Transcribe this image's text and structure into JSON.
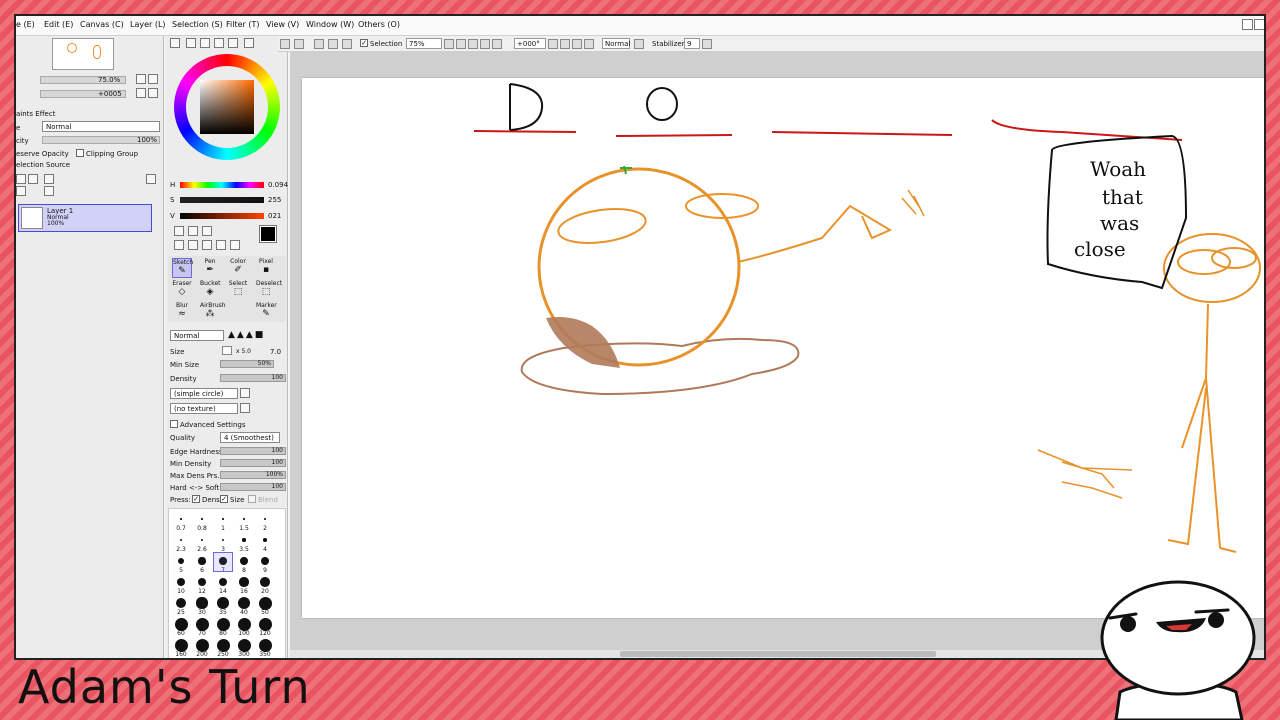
{
  "menu": {
    "items": [
      "e (E)",
      "Edit (E)",
      "Canvas (C)",
      "Layer (L)",
      "Selection (S)",
      "Filter (T)",
      "View (V)",
      "Window (W)",
      "Others (O)"
    ]
  },
  "toolbar": {
    "selection_label": "Selection",
    "zoom_value": "75%",
    "rotation_value": "+000°",
    "blend_mode": "Normal",
    "stabilizer_label": "Stabilizer",
    "stabilizer_value": "9"
  },
  "navigator": {
    "zoom_value": "75.0%",
    "angle_value": "+0005"
  },
  "layer_panel": {
    "section_title": "aints Effect",
    "mode_label": "e",
    "mode_value": "Normal",
    "opacity_label": "city",
    "opacity_value": "100%",
    "preserve_opacity_label": "eserve Opacity",
    "clipping_group_label": "Clipping Group",
    "selection_source_label": "election Source",
    "layer": {
      "name": "Layer 1",
      "mode": "Normal",
      "opacity": "100%"
    }
  },
  "color": {
    "h_label": "H",
    "h_value": "0.094",
    "s_label": "S",
    "s_value": "255",
    "v_label": "V",
    "v_value": "021"
  },
  "tools": {
    "row1": [
      {
        "label": "Sketch",
        "glyph": "✎"
      },
      {
        "label": "Pen",
        "glyph": "✒"
      },
      {
        "label": "Color",
        "glyph": "✐"
      },
      {
        "label": "Pixel",
        "glyph": "▪"
      }
    ],
    "row2": [
      {
        "label": "Eraser",
        "glyph": "◇"
      },
      {
        "label": "Bucket",
        "glyph": "◈"
      },
      {
        "label": "Select",
        "glyph": "⬚"
      },
      {
        "label": "Deselect",
        "glyph": "⬚"
      }
    ],
    "row3": [
      {
        "label": "Blur",
        "glyph": "≈"
      },
      {
        "label": "AirBrush",
        "glyph": "⁂"
      },
      {
        "label": "",
        "glyph": ""
      },
      {
        "label": "Marker",
        "glyph": "✎"
      }
    ]
  },
  "brush": {
    "blend_mode": "Normal",
    "size_label": "Size",
    "size_mult": "x 5.0",
    "size_value": "7.0",
    "min_size_label": "Min Size",
    "min_size_value": "50%",
    "density_label": "Density",
    "density_value": "100",
    "shape": "(simple circle)",
    "texture": "(no texture)",
    "advanced_label": "Advanced Settings",
    "quality_label": "Quality",
    "quality_value": "4 (Smoothest)",
    "edge_hardness_label": "Edge Hardness",
    "edge_hardness_value": "100",
    "min_density_label": "Min Density",
    "min_density_value": "100",
    "max_dens_label": "Max Dens Prs.",
    "max_dens_value": "100%",
    "hard_soft_label": "Hard <-> Soft",
    "hard_soft_value": "100",
    "press_label": "Press:",
    "dens_label": "Dens",
    "size_chk_label": "Size",
    "blend_label": "Blend"
  },
  "brush_sizes": [
    "0.7",
    "0.8",
    "1",
    "1.5",
    "2",
    "2.3",
    "2.6",
    "3",
    "3.5",
    "4",
    "5",
    "6",
    "7",
    "8",
    "9",
    "10",
    "12",
    "14",
    "16",
    "20",
    "25",
    "30",
    "35",
    "40",
    "50",
    "60",
    "70",
    "80",
    "100",
    "120",
    "160",
    "200",
    "250",
    "300",
    "350"
  ],
  "canvas": {
    "letters": [
      "D",
      "O"
    ],
    "speech": [
      "Woah",
      "that",
      "was",
      "close"
    ]
  },
  "caption": "Adam's Turn",
  "colors": {
    "stripe_bg": "#e8545f",
    "stroke_orange": "#e8922a",
    "stroke_red": "#c81818",
    "stroke_brown": "#b07a5a",
    "layer_highlight": "#d2d2f8"
  }
}
